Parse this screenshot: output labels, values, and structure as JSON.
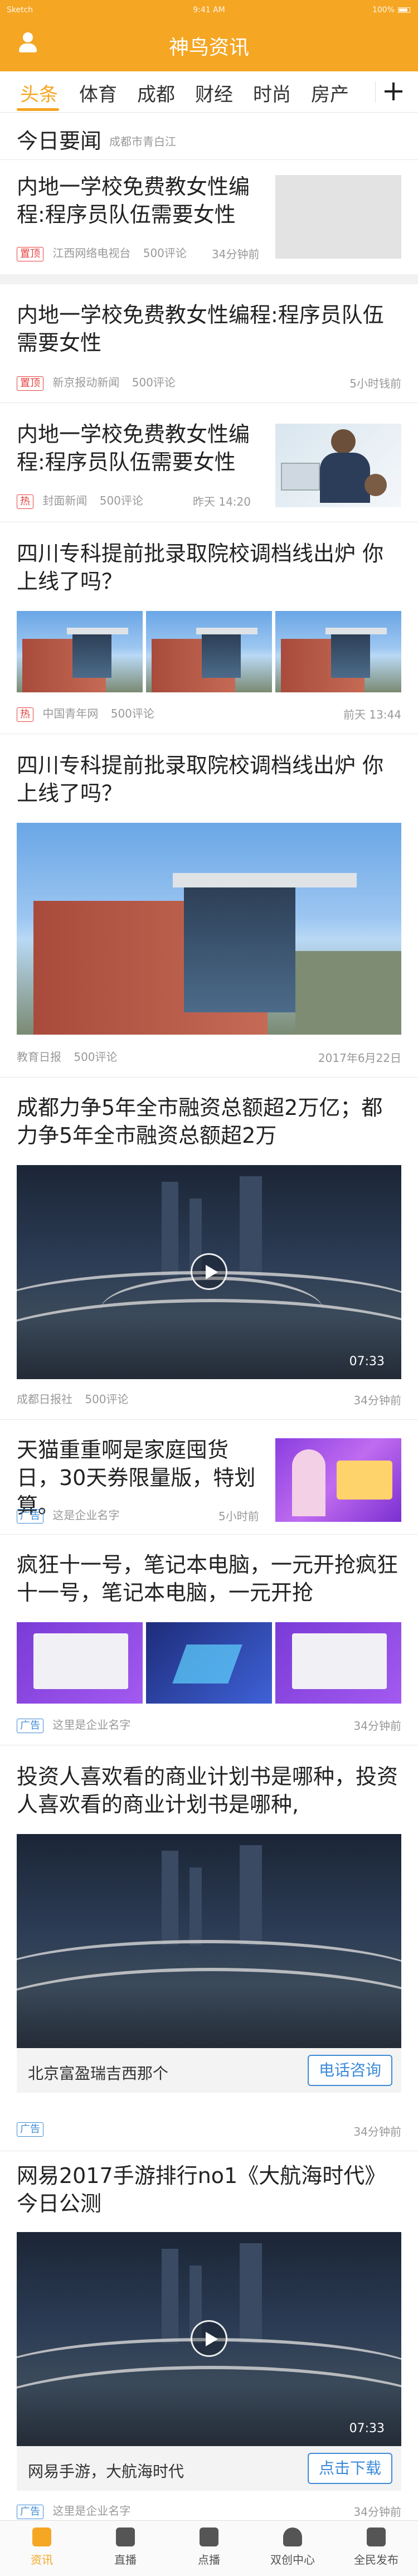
{
  "statusbar": {
    "carrier": "Sketch",
    "time": "9:41 AM",
    "battery": "100%"
  },
  "app": {
    "title": "神鸟资讯"
  },
  "tabs": [
    "头条",
    "体育",
    "成都",
    "财经",
    "时尚",
    "房产"
  ],
  "today": {
    "title": "今日要闻",
    "location": "成都市青白江"
  },
  "articles": [
    {
      "title": "内地一学校免费教女性编程:程序员队伍需要女性",
      "tag": "置顶",
      "source": "江西网络电视台",
      "comments": "500评论",
      "time": "34分钟前"
    },
    {
      "title": "内地一学校免费教女性编程:程序员队伍需要女性",
      "tag": "置顶",
      "source": "新京报动新闻",
      "comments": "500评论",
      "time": "5小时钱前"
    },
    {
      "title": "内地一学校免费教女性编程:程序员队伍需要女性",
      "tag": "热",
      "source": "封面新闻",
      "comments": "500评论",
      "time": "昨天 14:20"
    },
    {
      "title": "四川专科提前批录取院校调档线出炉  你上线了吗？",
      "tag": "热",
      "source": "中国青年网",
      "comments": "500评论",
      "time": "前天 13:44"
    },
    {
      "title": "四川专科提前批录取院校调档线出炉  你上线了吗？",
      "source": "教育日报",
      "comments": "500评论",
      "time": "2017年6月22日"
    },
    {
      "title": "成都力争5年全市融资总额超2万亿；都力争5年全市融资总额超2万",
      "source": "成都日报社",
      "comments": "500评论",
      "time": "34分钟前",
      "duration": "07:33"
    },
    {
      "title": "天猫重重啊是家庭囤货日，30天券限量版，特划算。",
      "tag": "广告",
      "source": "这是企业名字",
      "time": "5小时前"
    },
    {
      "title": "疯狂十一号，笔记本电脑，一元开抢疯狂十一号，笔记本电脑，一元开抢",
      "tag": "广告",
      "source": "这里是企业名字",
      "time": "34分钟前"
    },
    {
      "title": "投资人喜欢看的商业计划书是哪种，投资人喜欢看的商业计划书是哪种,",
      "bar_text": "北京富盈瑞吉西那个",
      "button": "电话咨询",
      "tag": "广告",
      "time": "34分钟前"
    },
    {
      "title": "网易2017手游排行no1《大航海时代》今日公测",
      "bar_text": "网易手游，大航海时代",
      "button": "点击下载",
      "tag": "广告",
      "source": "这里是企业名字",
      "time": "34分钟前",
      "duration": "07:33"
    }
  ],
  "nav": [
    "资讯",
    "直播",
    "点播",
    "双创中心",
    "全民发布"
  ],
  "colors": {
    "accent": "#f5a623",
    "hot_tag": "#e64340",
    "ad_tag": "#3d8bd8"
  }
}
